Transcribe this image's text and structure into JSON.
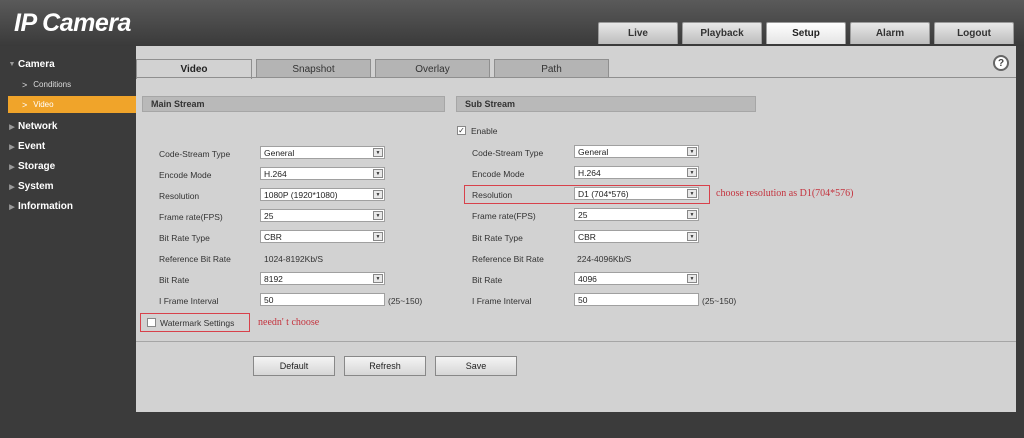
{
  "app": {
    "logo": "IP Camera"
  },
  "top_nav": {
    "tabs": [
      {
        "label": "Live"
      },
      {
        "label": "Playback"
      },
      {
        "label": "Setup",
        "active": true
      },
      {
        "label": "Alarm"
      },
      {
        "label": "Logout"
      }
    ]
  },
  "sidebar": {
    "camera": "Camera",
    "conditions": "Conditions",
    "video": "Video",
    "network": "Network",
    "event": "Event",
    "storage": "Storage",
    "system": "System",
    "information": "Information"
  },
  "sub_tabs": {
    "video": "Video",
    "snapshot": "Snapshot",
    "overlay": "Overlay",
    "path": "Path"
  },
  "help_icon": "?",
  "main_stream": {
    "title": "Main Stream",
    "code_stream_type": {
      "label": "Code-Stream Type",
      "value": "General"
    },
    "encode_mode": {
      "label": "Encode Mode",
      "value": "H.264"
    },
    "resolution": {
      "label": "Resolution",
      "value": "1080P (1920*1080)"
    },
    "frame_rate": {
      "label": "Frame rate(FPS)",
      "value": "25"
    },
    "bit_rate_type": {
      "label": "Bit Rate Type",
      "value": "CBR"
    },
    "reference_bit_rate": {
      "label": "Reference Bit Rate",
      "value": "1024-8192Kb/S"
    },
    "bit_rate": {
      "label": "Bit Rate",
      "value": "8192"
    },
    "i_frame_interval": {
      "label": "I Frame Interval",
      "value": "50",
      "range": "(25~150)"
    },
    "watermark": {
      "label": "Watermark Settings",
      "checked": false
    }
  },
  "sub_stream": {
    "title": "Sub Stream",
    "enable": {
      "label": "Enable",
      "checked": true
    },
    "code_stream_type": {
      "label": "Code-Stream Type",
      "value": "General"
    },
    "encode_mode": {
      "label": "Encode Mode",
      "value": "H.264"
    },
    "resolution": {
      "label": "Resolution",
      "value": "D1 (704*576)"
    },
    "frame_rate": {
      "label": "Frame rate(FPS)",
      "value": "25"
    },
    "bit_rate_type": {
      "label": "Bit Rate Type",
      "value": "CBR"
    },
    "reference_bit_rate": {
      "label": "Reference Bit Rate",
      "value": "224-4096Kb/S"
    },
    "bit_rate": {
      "label": "Bit Rate",
      "value": "4096"
    },
    "i_frame_interval": {
      "label": "I Frame Interval",
      "value": "50",
      "range": "(25~150)"
    }
  },
  "annotations": {
    "resolution_note": "choose resolution as D1(704*576)",
    "watermark_note": "needn' t choose"
  },
  "buttons": {
    "default": "Default",
    "refresh": "Refresh",
    "save": "Save"
  },
  "colors": {
    "active_nav": "#f0a42a",
    "annotation": "#c4333e",
    "panel": "#d2d2d2",
    "background": "#3b3b3b"
  }
}
